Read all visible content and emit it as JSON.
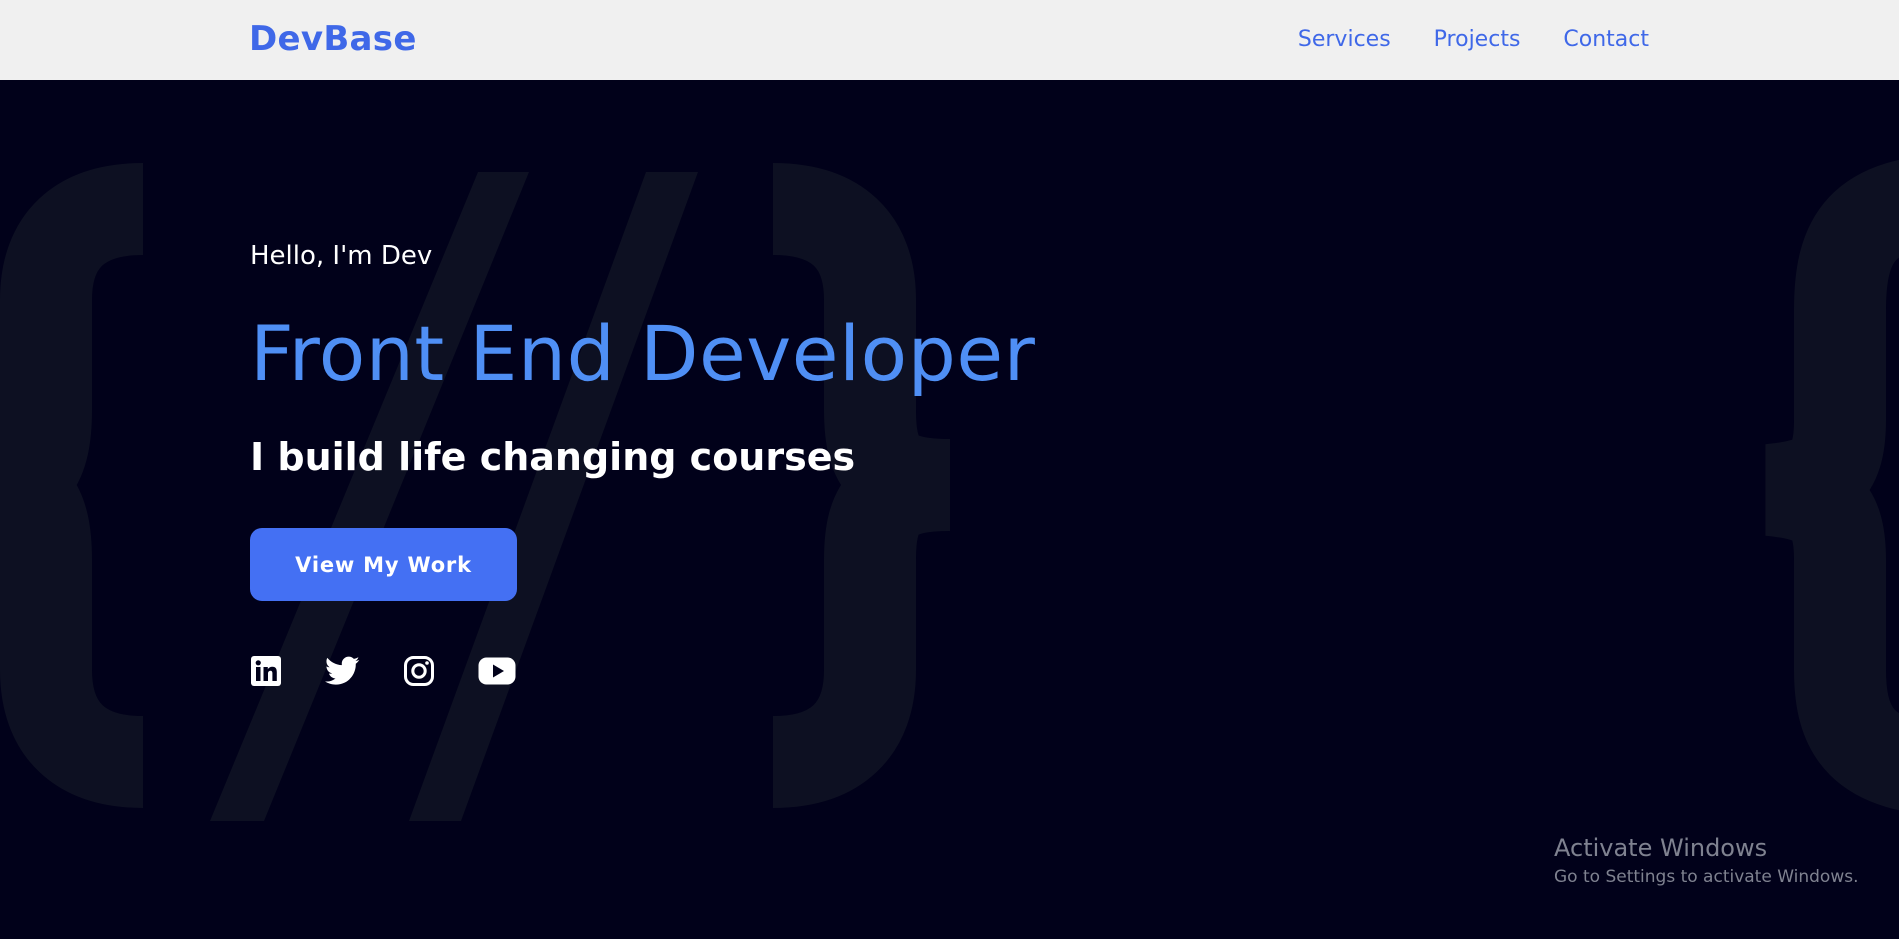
{
  "brand": {
    "name": "DevBase"
  },
  "nav": {
    "links": [
      {
        "label": "Services"
      },
      {
        "label": "Projects"
      },
      {
        "label": "Contact"
      }
    ]
  },
  "hero": {
    "greeting": "Hello, I'm Dev",
    "role": "Front End Developer",
    "tagline": "I build life changing courses",
    "cta_label": "View My Work",
    "decorative_glyphs": [
      "{",
      "//",
      "}",
      "}"
    ],
    "socials": [
      {
        "icon": "linkedin-icon"
      },
      {
        "icon": "twitter-icon"
      },
      {
        "icon": "instagram-icon"
      },
      {
        "icon": "youtube-icon"
      }
    ]
  },
  "os_watermark": {
    "title": "Activate Windows",
    "subtitle": "Go to Settings to activate Windows."
  },
  "colors": {
    "navbar_bg": "#f0f0f0",
    "brand_blue": "#3f68e8",
    "hero_bg": "#01011a",
    "role_blue": "#4f8ff5",
    "button_blue": "#4470f3",
    "glyph_color": "#0d1022",
    "text_white": "#ffffff"
  }
}
